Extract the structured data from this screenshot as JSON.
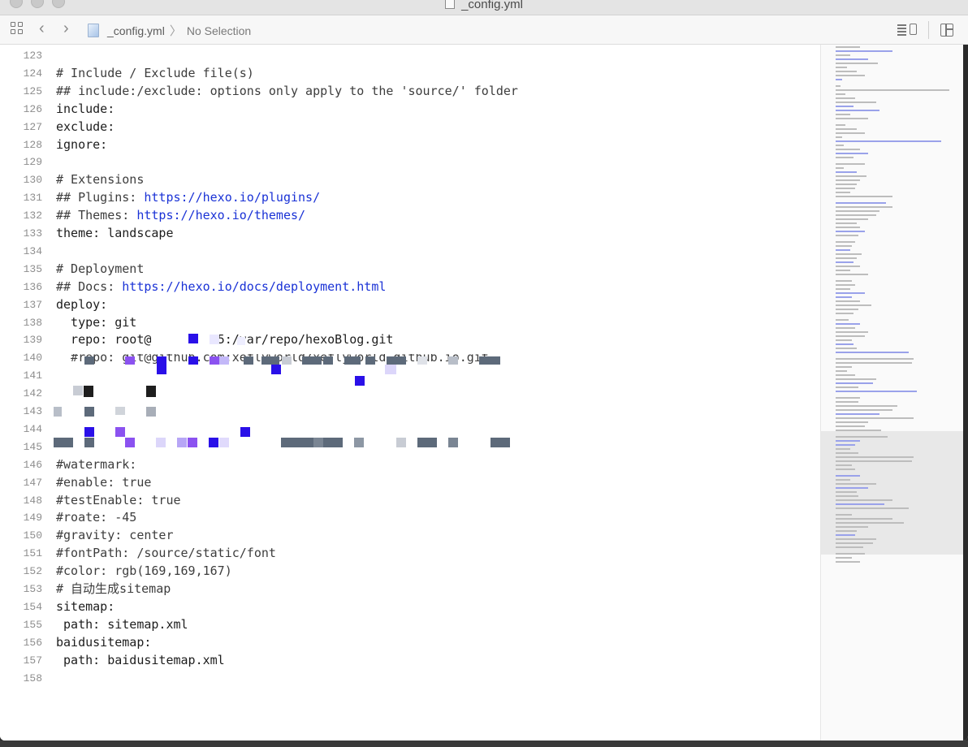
{
  "window": {
    "title": "_config.yml"
  },
  "jumpbar": {
    "file": "_config.yml",
    "selection": "No Selection",
    "back_glyph": "‹",
    "forward_glyph": "›",
    "separator": "〉"
  },
  "icons": {
    "layout": "related-items-grid-icon",
    "back": "chevron-left-icon",
    "forward": "chevron-right-icon",
    "file": "yml-file-icon",
    "editor_options": "lines-editor-options-icon",
    "add_editor": "add-editor-split-icon"
  },
  "colors": {
    "link": "#1a32d6",
    "redact_dark": "#5d6a7a",
    "redact_blue": "#2a10e8",
    "redact_purple": "#8b52f0",
    "redact_light": "#dcd6fa"
  },
  "editor": {
    "lines": [
      {
        "num": "123",
        "text": ""
      },
      {
        "num": "124",
        "text": "# Include / Exclude file(s)"
      },
      {
        "num": "125",
        "text": "## include:/exclude: options only apply to the 'source/' folder"
      },
      {
        "num": "126",
        "text": "include:"
      },
      {
        "num": "127",
        "text": "exclude:"
      },
      {
        "num": "128",
        "text": "ignore:"
      },
      {
        "num": "129",
        "text": ""
      },
      {
        "num": "130",
        "text": "# Extensions"
      },
      {
        "num": "131",
        "text": "## Plugins: ",
        "link": "https://hexo.io/plugins/"
      },
      {
        "num": "132",
        "text": "## Themes: ",
        "link": "https://hexo.io/themes/"
      },
      {
        "num": "133",
        "text": "theme: landscape"
      },
      {
        "num": "134",
        "text": ""
      },
      {
        "num": "135",
        "text": "# Deployment"
      },
      {
        "num": "136",
        "text": "## Docs: ",
        "link": "https://hexo.io/docs/deployment.html"
      },
      {
        "num": "137",
        "text": "deploy:"
      },
      {
        "num": "138",
        "text": "  type: git"
      },
      {
        "num": "139",
        "text": "  repo: root@",
        "text_after": "5:/var/repo/hexoBlog.git"
      },
      {
        "num": "140",
        "text": "  #repo: git@github.com:xeflyworld/xeflyworld.github.io.git"
      },
      {
        "num": "141",
        "text": ""
      },
      {
        "num": "142",
        "text": ""
      },
      {
        "num": "143",
        "text": ""
      },
      {
        "num": "144",
        "text": ""
      },
      {
        "num": "145",
        "text": ""
      },
      {
        "num": "146",
        "text": "#watermark:"
      },
      {
        "num": "147",
        "text": "#enable: true"
      },
      {
        "num": "148",
        "text": "#testEnable: true"
      },
      {
        "num": "149",
        "text": "#roate: -45"
      },
      {
        "num": "150",
        "text": "#gravity: center"
      },
      {
        "num": "151",
        "text": "#fontPath: /source/static/font"
      },
      {
        "num": "152",
        "text": "#color: rgb(169,169,167)"
      },
      {
        "num": "153",
        "text": "# 自动生成sitemap"
      },
      {
        "num": "154",
        "text": "sitemap:"
      },
      {
        "num": "155",
        "text": " path: sitemap.xml"
      },
      {
        "num": "156",
        "text": "baidusitemap:"
      },
      {
        "num": "157",
        "text": " path: baidusitemap.xml"
      },
      {
        "num": "158",
        "text": ""
      }
    ]
  }
}
